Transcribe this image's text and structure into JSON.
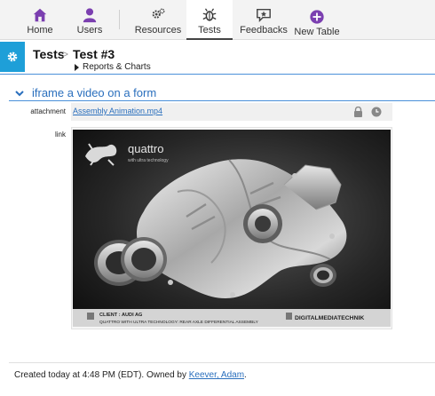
{
  "nav": {
    "items": [
      {
        "label": "Home",
        "icon": "home-icon"
      },
      {
        "label": "Users",
        "icon": "user-icon"
      },
      {
        "label": "Resources",
        "icon": "gears-icon"
      },
      {
        "label": "Tests",
        "icon": "bug-icon"
      },
      {
        "label": "Feedbacks",
        "icon": "feedback-icon"
      },
      {
        "label": "New Table",
        "icon": "plus-circle-icon"
      }
    ],
    "active": "Tests",
    "accent_color": "#7b3fb0"
  },
  "header": {
    "crumb_root": "Tests",
    "separator": ">",
    "crumb_current": "Test #3",
    "sublink": "Reports & Charts",
    "gear_color": "#1e9fd8"
  },
  "section": {
    "title": "iframe a video on a form"
  },
  "fields": {
    "attachment_label": "attachment",
    "attachment_value": "Assembly Animation.mp4",
    "link_label": "link"
  },
  "video": {
    "brand_text": "quattro",
    "brand_sub": "with ultra technology",
    "caption_client": "CLIENT : AUDI AG",
    "caption_desc": "QUATTRO WITH ULTRA TECHNOLOGY:  REAR AXLE DIFFERENTIAL ASSEMBLY",
    "studio": "DIGITALMEDIATECHNIK"
  },
  "footer": {
    "prefix": "Created today at  4:48 PM (EDT). Owned by ",
    "owner": "Keever, Adam",
    "suffix": "."
  }
}
